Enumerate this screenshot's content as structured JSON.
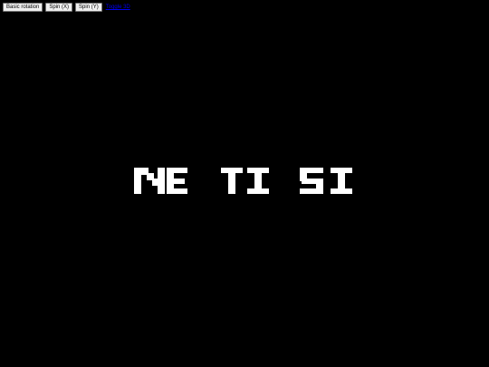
{
  "toolbar": {
    "buttons": [
      {
        "label": "Basic rotation"
      },
      {
        "label": "Spin (X)"
      },
      {
        "label": "Spin (Y)"
      }
    ],
    "link_label": "Toggle 3D"
  },
  "scene": {
    "background_color": "#000000",
    "text_color": "#ffffff",
    "words": [
      "NE",
      "TI",
      "SI"
    ]
  }
}
